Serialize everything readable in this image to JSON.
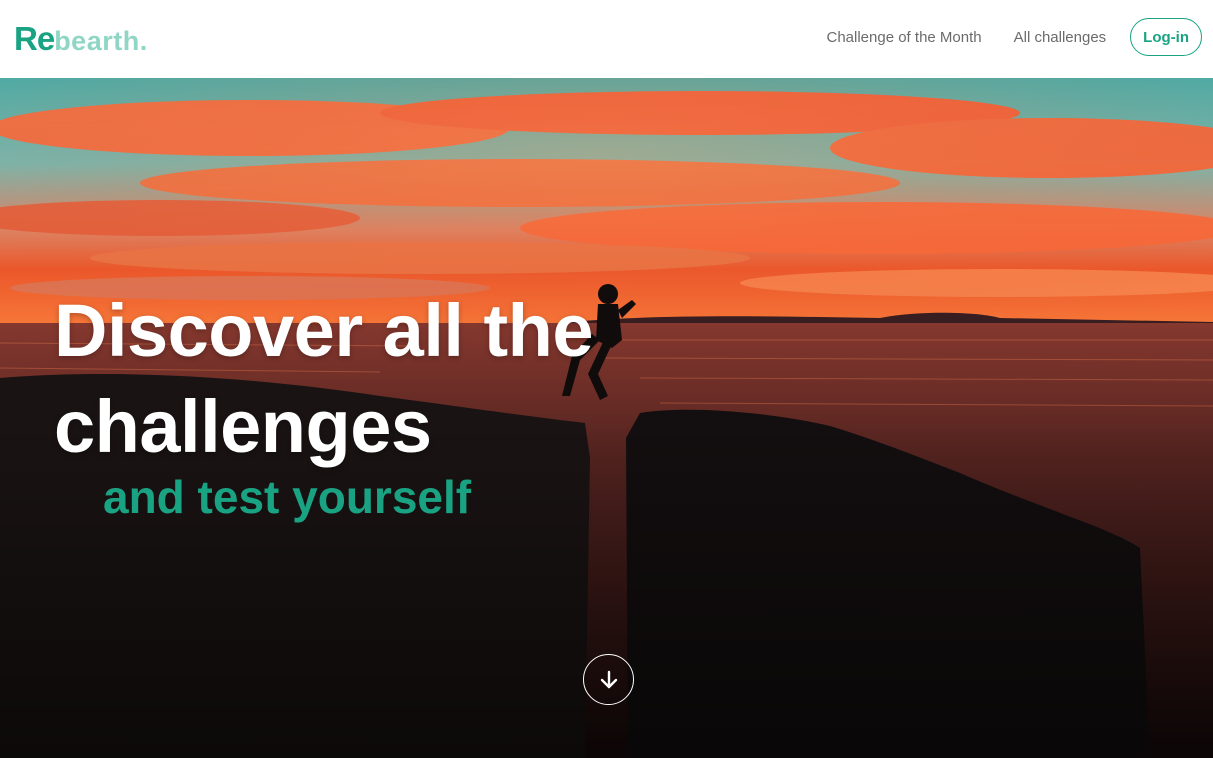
{
  "brand": {
    "logo_re": "Re",
    "logo_rest": "bearth.",
    "primary_color": "#1aa383",
    "light_color": "#8fd6c4"
  },
  "nav": {
    "items": [
      {
        "label": "Challenge of the Month"
      },
      {
        "label": "All challenges"
      }
    ],
    "login_label": "Log-in"
  },
  "hero": {
    "headline_line1": "Discover all the",
    "headline_line2": "challenges",
    "subheadline": "and test yourself",
    "scroll_icon": "arrow-down-icon",
    "background": "sunset-cliff-jump-photo"
  }
}
